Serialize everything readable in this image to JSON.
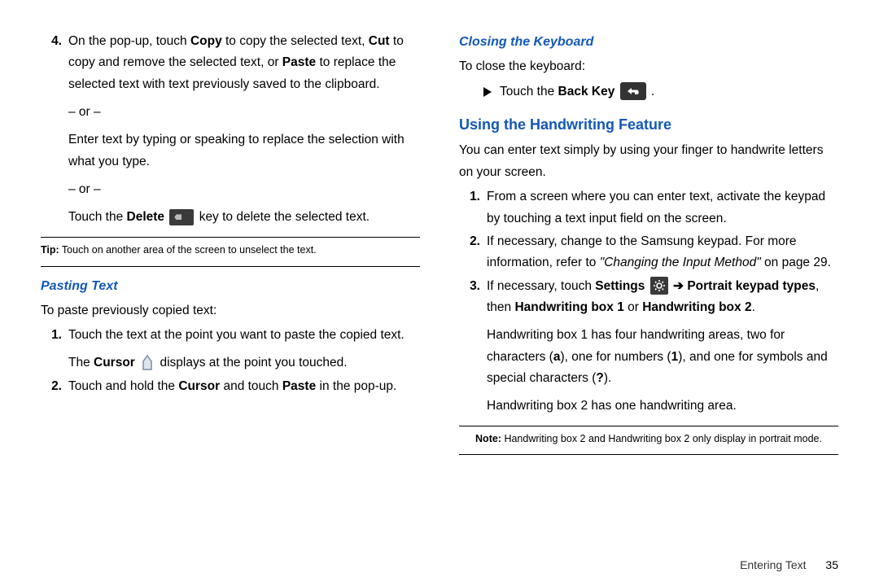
{
  "left": {
    "item4": {
      "num": "4.",
      "p1a": "On the pop-up, touch ",
      "p1b_copy": "Copy",
      "p1c": " to copy the selected text, ",
      "p1d_cut": "Cut",
      "p1e": " to copy and remove the selected text, or ",
      "p1f_paste": "Paste",
      "p1g": " to replace the selected text with text previously saved to the clipboard.",
      "or1": "– or –",
      "p2": "Enter text by typing or speaking to replace the selection with what you type.",
      "or2": "– or –",
      "p3a": "Touch the ",
      "p3b_delete": "Delete",
      "p3c": " key to delete the selected text."
    },
    "tip_label": "Tip:",
    "tip_text": " Touch on another area of the screen to unselect the text.",
    "pasting_heading": "Pasting Text",
    "pasting_intro": "To paste previously copied text:",
    "p_item1": {
      "num": "1.",
      "text": "Touch the text at the point you want to paste the copied text.",
      "sub_a": "The ",
      "sub_b": "Cursor",
      "sub_c": " displays at the point you touched."
    },
    "p_item2": {
      "num": "2.",
      "a": "Touch and hold the ",
      "b": "Cursor",
      "c": " and touch ",
      "d": "Paste",
      "e": " in the pop-up."
    }
  },
  "right": {
    "closing_heading": "Closing the Keyboard",
    "closing_intro": "To close the keyboard:",
    "back_a": "Touch the ",
    "back_b": "Back Key",
    "back_c": " .",
    "hw_heading": "Using the Handwriting Feature",
    "hw_intro": "You can enter text simply by using your finger to handwrite letters on your screen.",
    "h1": {
      "num": "1.",
      "text": "From a screen where you can enter text, activate the keypad by touching a text input field on the screen."
    },
    "h2": {
      "num": "2.",
      "a": "If necessary, change to the Samsung keypad. For more information, refer to ",
      "b": "\"Changing the Input Method\"",
      "c": " on page 29."
    },
    "h3": {
      "num": "3.",
      "a": "If necessary, touch ",
      "b": "Settings",
      "c": " ",
      "arrow": "➔",
      "d": " Portrait keypad types",
      "e": ", then ",
      "f": "Handwriting box 1",
      "g": " or ",
      "h": "Handwriting box 2",
      "i": ".",
      "p2a": "Handwriting box 1 has four handwriting areas, two for characters (",
      "p2b": "a",
      "p2c": "), one for numbers (",
      "p2d": "1",
      "p2e": "), and one for symbols and special characters (",
      "p2f": "?",
      "p2g": ").",
      "p3": "Handwriting box 2 has one handwriting area."
    },
    "note_label": "Note:",
    "note_text": " Handwriting box 2 and Handwriting box 2 only display in portrait mode."
  },
  "footer": {
    "section": "Entering Text",
    "page": "35"
  }
}
